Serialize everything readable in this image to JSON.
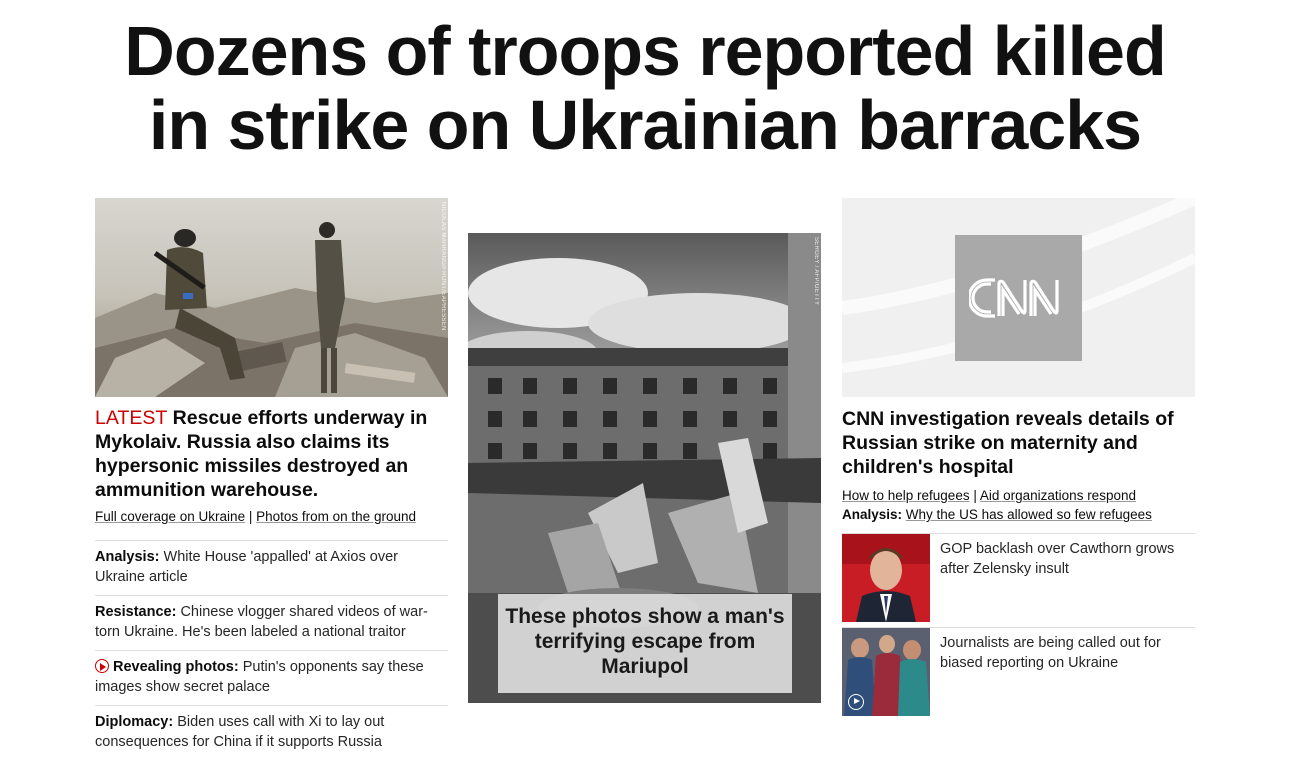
{
  "headline": {
    "line1": "Dozens of troops reported killed",
    "line2": "in strike on Ukrainian barracks"
  },
  "left": {
    "photo_credit": "NICOLAS MAHRANG/FRONT/EAPRESSEN",
    "latest_label": "LATEST",
    "lead_text": "Rescue efforts underway in Mykolaiv. Russia also claims its hypersonic missiles destroyed an ammunition warehouse.",
    "sublink1": "Full coverage on Ukraine",
    "separator": "|",
    "sublink2": "Photos from on the ground",
    "stories": [
      {
        "kicker": "Analysis:",
        "text": "White House 'appalled' at Axios over Ukraine article"
      },
      {
        "kicker": "Resistance:",
        "text": "Chinese vlogger shared videos of war-torn Ukraine. He's been labeled a national traitor"
      },
      {
        "kicker": "Revealing photos:",
        "text": "Putin's opponents say these images show secret palace"
      },
      {
        "kicker": "Diplomacy:",
        "text": "Biden uses call with Xi to lay out consequences for China if it supports Russia"
      }
    ]
  },
  "middle": {
    "photo_credit": "SERGEY / AFP/GETTY",
    "caption": "These photos show a man's terrifying escape from Mariupol"
  },
  "right": {
    "logo_text": "CNN",
    "lead_text": "CNN investigation reveals details of Russian strike on maternity and children's hospital",
    "sublink1": "How to help refugees",
    "separator": "|",
    "sublink2": "Aid organizations respond",
    "analysis_kicker": "Analysis:",
    "analysis_link": "Why the US has allowed so few refugees",
    "thumb_stories": [
      {
        "text": "GOP backlash over Cawthorn grows after Zelensky insult"
      },
      {
        "text": "Journalists are being called out for biased reporting on Ukraine"
      }
    ]
  },
  "colors": {
    "accent_red": "#cc0000",
    "text": "#0c0c0c",
    "divider": "#dedede"
  }
}
